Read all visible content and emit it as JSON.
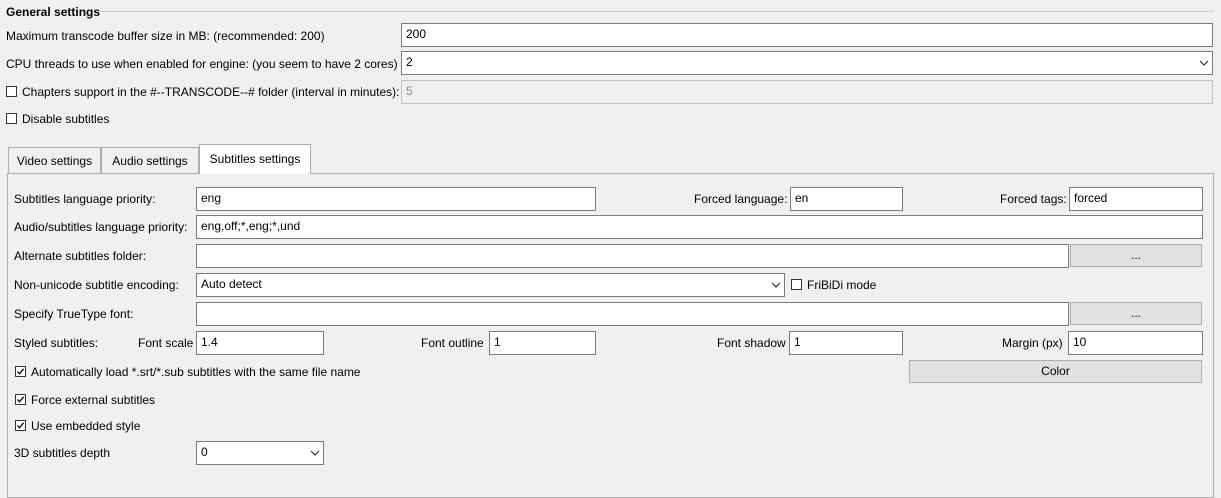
{
  "general": {
    "title": "General settings",
    "buffer_label": "Maximum transcode buffer size in MB: (recommended: 200)",
    "buffer_value": "200",
    "threads_label": "CPU threads to use when enabled for engine: (you seem to have 2 cores)",
    "threads_value": "2",
    "chapters_label": "Chapters support in the #--TRANSCODE--# folder (interval in minutes):",
    "chapters_checked": false,
    "chapters_value": "5",
    "disable_subs_label": "Disable subtitles",
    "disable_subs_checked": false
  },
  "tabs": [
    {
      "label": "Video settings",
      "active": false
    },
    {
      "label": "Audio settings",
      "active": false
    },
    {
      "label": "Subtitles settings",
      "active": true
    }
  ],
  "subtitles": {
    "lang_priority_label": "Subtitles language priority:",
    "lang_priority_value": "eng",
    "forced_lang_label": "Forced language:",
    "forced_lang_value": "en",
    "forced_tags_label": "Forced tags:",
    "forced_tags_value": "forced",
    "audio_sub_priority_label": "Audio/subtitles language priority:",
    "audio_sub_priority_value": "eng,off;*,eng;*,und",
    "alt_folder_label": "Alternate subtitles folder:",
    "alt_folder_value": "",
    "browse_label": "...",
    "encoding_label": "Non-unicode subtitle encoding:",
    "encoding_value": "Auto detect",
    "fribidi_label": "FriBiDi mode",
    "fribidi_checked": false,
    "truetype_label": "Specify TrueType font:",
    "truetype_value": "",
    "styled_label": "Styled subtitles:",
    "font_scale_label": "Font scale",
    "font_scale_value": "1.4",
    "font_outline_label": "Font outline",
    "font_outline_value": "1",
    "font_shadow_label": "Font shadow",
    "font_shadow_value": "1",
    "margin_label": "Margin (px)",
    "margin_value": "10",
    "autoload_label": "Automatically load *.srt/*.sub subtitles with the same file name",
    "autoload_checked": true,
    "color_label": "Color",
    "force_external_label": "Force external subtitles",
    "force_external_checked": true,
    "embedded_style_label": "Use embedded style",
    "embedded_style_checked": true,
    "depth_label": "3D subtitles depth",
    "depth_value": "0"
  }
}
